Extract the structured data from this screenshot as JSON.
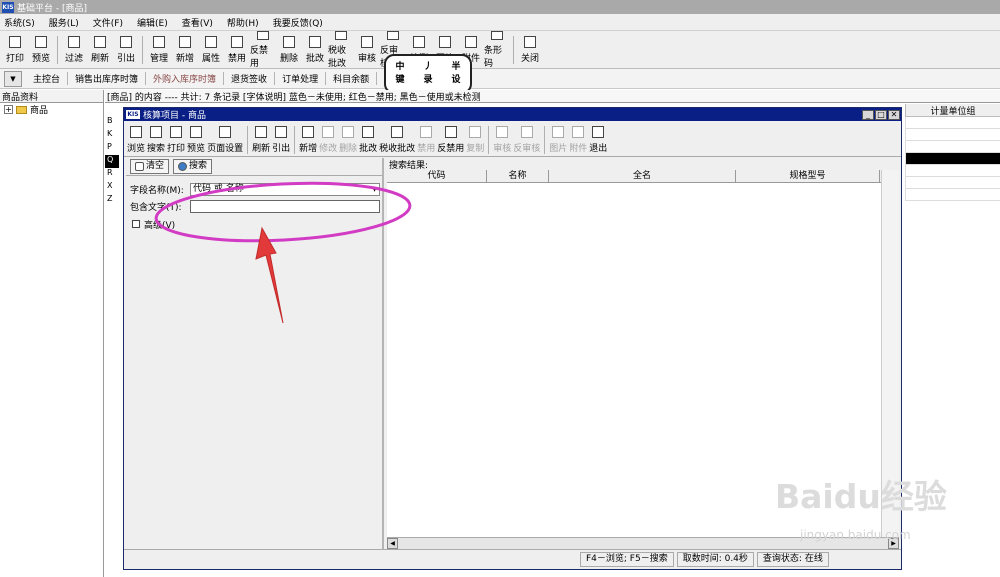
{
  "window": {
    "logo": "KIS",
    "title": "基础平台 - [商品]"
  },
  "menu": [
    "系统(S)",
    "服务(L)",
    "文件(F)",
    "编辑(E)",
    "查看(V)",
    "帮助(H)",
    "我要反馈(Q)"
  ],
  "toolbar": [
    {
      "label": "打印",
      "icon": "print-icon"
    },
    {
      "label": "预览",
      "icon": "preview-icon"
    },
    {
      "label": "过滤",
      "icon": "filter-icon"
    },
    {
      "label": "刷新",
      "icon": "refresh-icon"
    },
    {
      "label": "引出",
      "icon": "export-icon"
    },
    {
      "label": "管理",
      "icon": "manage-icon"
    },
    {
      "label": "新增",
      "icon": "new-icon"
    },
    {
      "label": "属性",
      "icon": "properties-icon"
    },
    {
      "label": "禁用",
      "icon": "disable-icon"
    },
    {
      "label": "反禁用",
      "icon": "enable-icon"
    },
    {
      "label": "删除",
      "icon": "delete-icon"
    },
    {
      "label": "批改",
      "icon": "batch-edit-icon"
    },
    {
      "label": "税收批改",
      "icon": "tax-edit-icon"
    },
    {
      "label": "审核",
      "icon": "approve-icon"
    },
    {
      "label": "反审核",
      "icon": "unapprove-icon"
    },
    {
      "label": "检测",
      "icon": "check-icon"
    },
    {
      "label": "图片",
      "icon": "image-icon"
    },
    {
      "label": "附件",
      "icon": "attachment-icon"
    },
    {
      "label": "条形码",
      "icon": "barcode-icon"
    },
    {
      "label": "关闭",
      "icon": "close-icon"
    }
  ],
  "nav": {
    "items": [
      "主控台",
      "销售出库序时簿",
      "外购入库序时簿",
      "退货签收",
      "订单处理",
      "科目余额"
    ],
    "active_tab": "商品"
  },
  "sticker": [
    "中",
    "丿",
    "半",
    "键",
    "录",
    "设"
  ],
  "left_panel": {
    "title": "商品资料",
    "tree_root": "商品"
  },
  "main_panel": {
    "info": "[商品] 的内容 ---- 共计: 7 条记录  [字体说明] 蓝色－未使用; 红色－禁用; 黑色－使用或未检测",
    "letters": [
      "B",
      "K",
      "P",
      "Q",
      "R",
      "X",
      "Z"
    ],
    "right_header": "计量单位组"
  },
  "dialog": {
    "logo": "KIS",
    "title": "核算项目 - 商品",
    "toolbar": [
      {
        "label": "浏览",
        "icon": "browse-icon",
        "disabled": false
      },
      {
        "label": "搜索",
        "icon": "search-icon",
        "disabled": false
      },
      {
        "label": "打印",
        "icon": "print-icon",
        "disabled": false
      },
      {
        "label": "预览",
        "icon": "preview-icon",
        "disabled": false
      },
      {
        "label": "页面设置",
        "icon": "page-setup-icon",
        "disabled": false
      },
      {
        "label": "刷新",
        "icon": "refresh-icon",
        "disabled": false
      },
      {
        "label": "引出",
        "icon": "export-icon",
        "disabled": false
      },
      {
        "label": "新增",
        "icon": "new-icon",
        "disabled": false
      },
      {
        "label": "修改",
        "icon": "edit-icon",
        "disabled": true
      },
      {
        "label": "删除",
        "icon": "delete-icon",
        "disabled": true
      },
      {
        "label": "批改",
        "icon": "batch-edit-icon",
        "disabled": false
      },
      {
        "label": "税收批改",
        "icon": "tax-edit-icon",
        "disabled": false
      },
      {
        "label": "禁用",
        "icon": "disable-icon",
        "disabled": true
      },
      {
        "label": "反禁用",
        "icon": "enable-icon",
        "disabled": false
      },
      {
        "label": "复制",
        "icon": "copy-icon",
        "disabled": true
      },
      {
        "label": "审核",
        "icon": "approve-icon",
        "disabled": true
      },
      {
        "label": "反审核",
        "icon": "unapprove-icon",
        "disabled": true
      },
      {
        "label": "图片",
        "icon": "image-icon",
        "disabled": true
      },
      {
        "label": "附件",
        "icon": "attachment-icon",
        "disabled": true
      },
      {
        "label": "退出",
        "icon": "exit-icon",
        "disabled": false
      }
    ],
    "search": {
      "clear_label": "清空",
      "search_label": "搜索",
      "field_label": "字段名称(M):",
      "field_value": "代码 或 名称",
      "contains_label": "包含文字(T):",
      "contains_value": "",
      "advanced_label": "高级(V)"
    },
    "results": {
      "title": "搜索结果:",
      "columns": [
        "代码",
        "名称",
        "全名",
        "规格型号"
      ]
    },
    "status": [
      "F4－浏览; F5－搜索",
      "取数时间: 0.4秒",
      "查询状态: 在线"
    ]
  },
  "watermark": {
    "logo": "Baidu经验",
    "url": "jingyan.baidu.com"
  },
  "colors": {
    "annotation": "#d23bc4",
    "dialog_title": "#0a1f86",
    "active_tab": "#e06a2c"
  }
}
